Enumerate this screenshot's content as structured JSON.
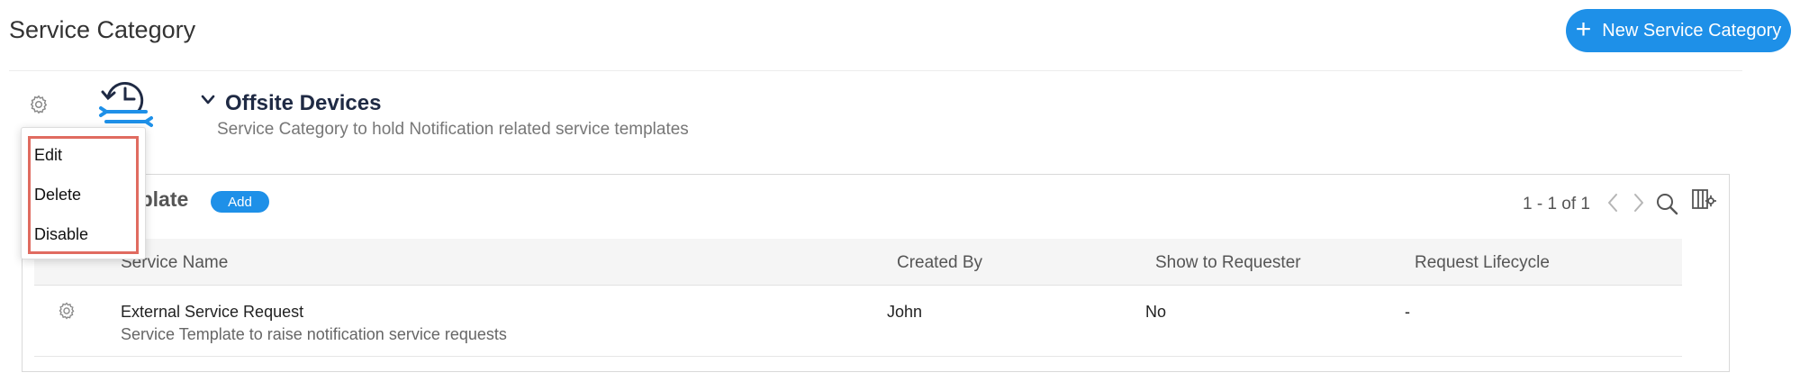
{
  "header": {
    "title": "Service Category",
    "new_button_label": "New Service Category",
    "new_button_icon": "plus-icon"
  },
  "category": {
    "name": "Offsite Devices",
    "description": "Service Category to hold Notification related service templates",
    "icon": "clock-wrench-icon"
  },
  "context_menu": {
    "items": [
      "Edit",
      "Delete",
      "Disable"
    ]
  },
  "template_panel": {
    "title": "Template",
    "add_label": "Add",
    "pagination": "1 - 1 of 1",
    "columns": [
      "Service Name",
      "Created By",
      "Show to Requester",
      "Request Lifecycle"
    ],
    "rows": [
      {
        "service_name": "External Service Request",
        "description": "Service Template to raise notification service requests",
        "created_by": "John",
        "show_to_requester": "No",
        "request_lifecycle": "-"
      }
    ]
  },
  "colors": {
    "accent": "#1e90e8",
    "highlight_border": "#e06b60",
    "category_title": "#1f2a44"
  }
}
